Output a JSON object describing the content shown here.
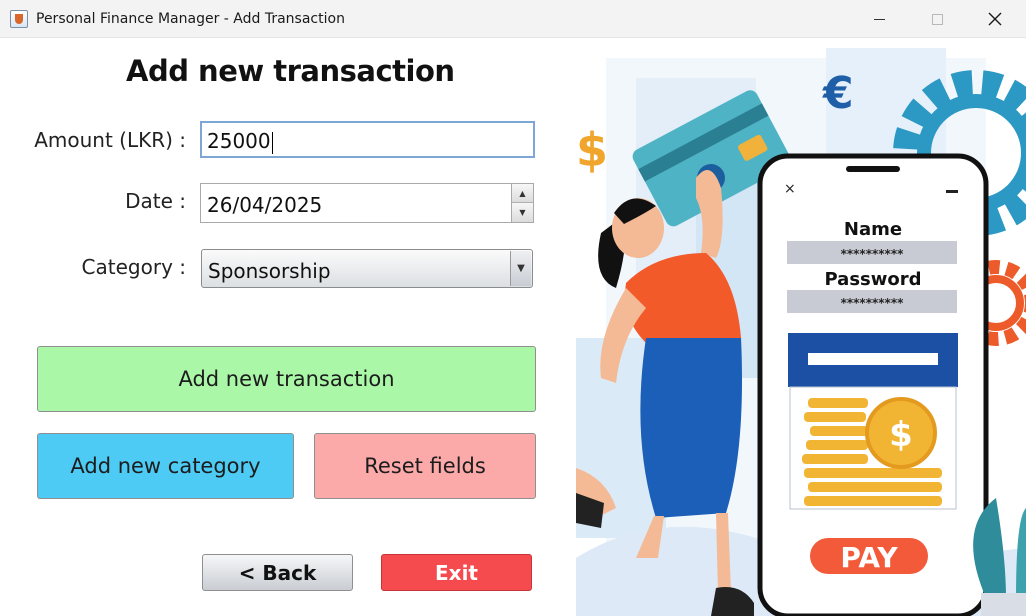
{
  "window": {
    "title": "Personal Finance Manager - Add Transaction",
    "controls": [
      "minimize",
      "maximize",
      "close"
    ]
  },
  "form": {
    "heading": "Add new transaction",
    "amount": {
      "label": "Amount (LKR) :",
      "value": "25000"
    },
    "date": {
      "label": "Date :",
      "value": "26/04/2025"
    },
    "category": {
      "label": "Category :",
      "selected": "Sponsorship"
    }
  },
  "buttons": {
    "add_transaction": "Add new transaction",
    "add_category": "Add new category",
    "reset": "Reset fields",
    "back": "< Back",
    "exit": "Exit"
  },
  "illustration": {
    "name_label": "Name",
    "name_mask": "**********",
    "password_label": "Password",
    "password_mask": "**********",
    "pay_label": "PAY",
    "dollar_symbol": "$",
    "euro_symbol": "€",
    "close_mark": "×"
  },
  "colors": {
    "add_transaction_bg": "#aaf7a8",
    "add_category_bg": "#4dcbf5",
    "reset_bg": "#fca9a9",
    "exit_bg": "#f54a4e",
    "pay_bg": "#f35a3a"
  }
}
